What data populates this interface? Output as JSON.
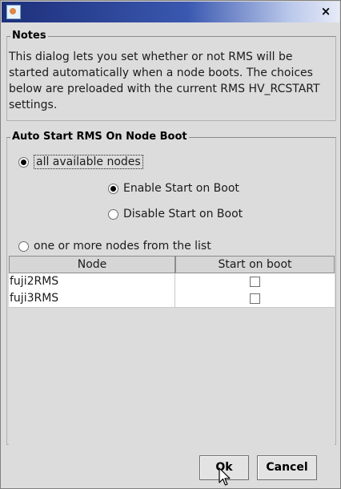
{
  "window": {
    "title": "",
    "close_glyph": "×"
  },
  "notes": {
    "title": "Notes",
    "text": "This dialog lets you set whether or not RMS will be started automatically when a node boots. The choices below are preloaded with the current RMS HV_RCSTART settings."
  },
  "auto_start": {
    "title": "Auto Start RMS On Node Boot",
    "option_all": {
      "label": "all available nodes",
      "selected": true
    },
    "option_enable": {
      "label": "Enable Start on Boot",
      "selected": true
    },
    "option_disable": {
      "label": "Disable Start on Boot",
      "selected": false
    },
    "option_list": {
      "label": "one or more nodes from the list",
      "selected": false
    },
    "table": {
      "columns": [
        "Node",
        "Start on boot"
      ],
      "rows": [
        {
          "node": "fuji2RMS",
          "start_on_boot": false
        },
        {
          "node": "fuji3RMS",
          "start_on_boot": false
        }
      ]
    }
  },
  "buttons": {
    "ok": "Ok",
    "cancel": "Cancel"
  },
  "icons": [
    "app-icon",
    "close-icon",
    "mouse-cursor-icon"
  ]
}
